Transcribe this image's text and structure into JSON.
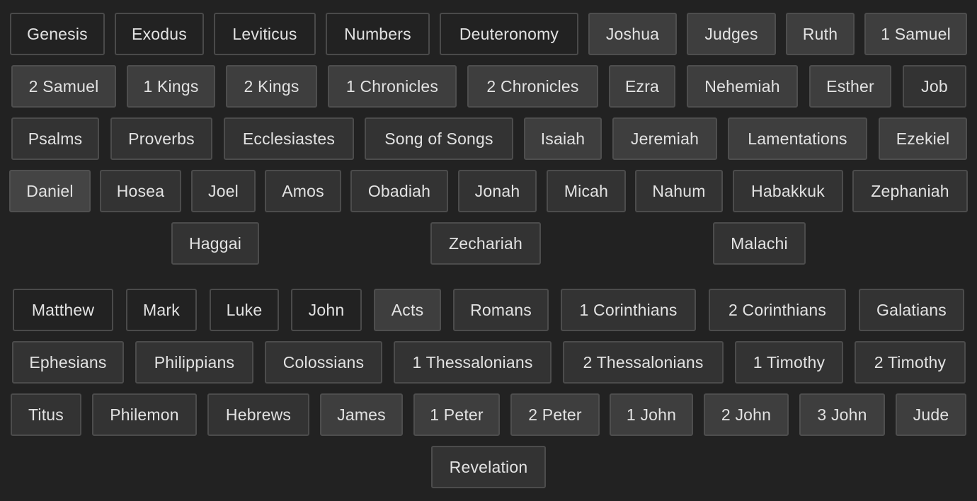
{
  "old_testament": {
    "rows": [
      [
        {
          "label": "Genesis",
          "shade": "dark"
        },
        {
          "label": "Exodus",
          "shade": "dark"
        },
        {
          "label": "Leviticus",
          "shade": "dark"
        },
        {
          "label": "Numbers",
          "shade": "dark"
        },
        {
          "label": "Deuteronomy",
          "shade": "dark"
        },
        {
          "label": "Joshua",
          "shade": "light"
        },
        {
          "label": "Judges",
          "shade": "light"
        },
        {
          "label": "Ruth",
          "shade": "light"
        },
        {
          "label": "1 Samuel",
          "shade": "light"
        }
      ],
      [
        {
          "label": "2 Samuel",
          "shade": "light"
        },
        {
          "label": "1 Kings",
          "shade": "light"
        },
        {
          "label": "2 Kings",
          "shade": "light"
        },
        {
          "label": "1 Chronicles",
          "shade": "light"
        },
        {
          "label": "2 Chronicles",
          "shade": "light"
        },
        {
          "label": "Ezra",
          "shade": "light"
        },
        {
          "label": "Nehemiah",
          "shade": "light"
        },
        {
          "label": "Esther",
          "shade": "light"
        },
        {
          "label": "Job",
          "shade": "mid"
        }
      ],
      [
        {
          "label": "Psalms",
          "shade": "mid"
        },
        {
          "label": "Proverbs",
          "shade": "mid"
        },
        {
          "label": "Ecclesiastes",
          "shade": "mid"
        },
        {
          "label": "Song of Songs",
          "shade": "mid"
        },
        {
          "label": "Isaiah",
          "shade": "light"
        },
        {
          "label": "Jeremiah",
          "shade": "light"
        },
        {
          "label": "Lamentations",
          "shade": "light"
        },
        {
          "label": "Ezekiel",
          "shade": "light"
        }
      ],
      [
        {
          "label": "Daniel",
          "shade": "light2"
        },
        {
          "label": "Hosea",
          "shade": "mid"
        },
        {
          "label": "Joel",
          "shade": "mid"
        },
        {
          "label": "Amos",
          "shade": "mid"
        },
        {
          "label": "Obadiah",
          "shade": "mid"
        },
        {
          "label": "Jonah",
          "shade": "mid"
        },
        {
          "label": "Micah",
          "shade": "mid"
        },
        {
          "label": "Nahum",
          "shade": "mid"
        },
        {
          "label": "Habakkuk",
          "shade": "mid"
        },
        {
          "label": "Zephaniah",
          "shade": "mid"
        }
      ],
      [
        {
          "label": "Haggai",
          "shade": "mid"
        },
        {
          "label": "Zechariah",
          "shade": "mid"
        },
        {
          "label": "Malachi",
          "shade": "mid"
        }
      ]
    ]
  },
  "new_testament": {
    "rows": [
      [
        {
          "label": "Matthew",
          "shade": "dark"
        },
        {
          "label": "Mark",
          "shade": "dark"
        },
        {
          "label": "Luke",
          "shade": "dark"
        },
        {
          "label": "John",
          "shade": "dark"
        },
        {
          "label": "Acts",
          "shade": "light"
        },
        {
          "label": "Romans",
          "shade": "mid"
        },
        {
          "label": "1 Corinthians",
          "shade": "mid"
        },
        {
          "label": "2 Corinthians",
          "shade": "mid"
        },
        {
          "label": "Galatians",
          "shade": "mid"
        }
      ],
      [
        {
          "label": "Ephesians",
          "shade": "mid"
        },
        {
          "label": "Philippians",
          "shade": "mid"
        },
        {
          "label": "Colossians",
          "shade": "mid"
        },
        {
          "label": "1 Thessalonians",
          "shade": "mid"
        },
        {
          "label": "2 Thessalonians",
          "shade": "mid"
        },
        {
          "label": "1 Timothy",
          "shade": "mid"
        },
        {
          "label": "2 Timothy",
          "shade": "mid"
        }
      ],
      [
        {
          "label": "Titus",
          "shade": "mid"
        },
        {
          "label": "Philemon",
          "shade": "mid"
        },
        {
          "label": "Hebrews",
          "shade": "mid"
        },
        {
          "label": "James",
          "shade": "light"
        },
        {
          "label": "1 Peter",
          "shade": "light"
        },
        {
          "label": "2 Peter",
          "shade": "light"
        },
        {
          "label": "1 John",
          "shade": "light"
        },
        {
          "label": "2 John",
          "shade": "light"
        },
        {
          "label": "3 John",
          "shade": "light"
        },
        {
          "label": "Jude",
          "shade": "light"
        }
      ],
      [
        {
          "label": "Revelation",
          "shade": "mid"
        }
      ]
    ]
  }
}
